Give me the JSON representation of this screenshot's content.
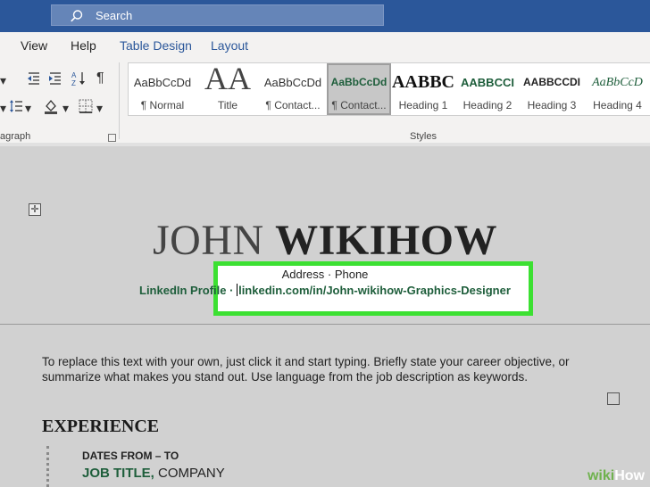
{
  "search": {
    "label": "Search"
  },
  "tabs": [
    {
      "label": "View"
    },
    {
      "label": "Help"
    },
    {
      "label": "Table Design"
    },
    {
      "label": "Layout"
    }
  ],
  "ribbon": {
    "paragraph_label": "agraph",
    "styles_label": "Styles",
    "styles": [
      {
        "sample": "AaBbCcDd",
        "name": "¶ Normal"
      },
      {
        "sample": "AA",
        "name": "Title"
      },
      {
        "sample": "AaBbCcDd",
        "name": "¶ Contact..."
      },
      {
        "sample": "AaBbCcDd",
        "name": "¶ Contact...",
        "selected": true
      },
      {
        "sample": "AABBC",
        "name": "Heading 1"
      },
      {
        "sample": "AABBCCI",
        "name": "Heading 2"
      },
      {
        "sample": "AABBCCDI",
        "name": "Heading 3"
      },
      {
        "sample": "AaBbCcD",
        "name": "Heading 4"
      }
    ]
  },
  "document": {
    "name_first": "JOHN",
    "name_last": "WIKIHOW",
    "contact_line1": "Address · Phone",
    "contact_line2_prefix": "LinkedIn Profile · ",
    "contact_url": "linkedin.com/in/John-wikihow-Graphics-Designer",
    "objective": "To replace this text with your own, just click it and start typing. Briefly state your career objective, or summarize what makes you stand out. Use language from the job description as keywords.",
    "section_heading": "EXPERIENCE",
    "dates": "DATES FROM – TO",
    "job_title": "JOB TITLE,",
    "company": " COMPANY"
  },
  "watermark": {
    "wiki": "wiki",
    "how": "How"
  },
  "colors": {
    "titlebar": "#2b579a",
    "highlight": "#3ce032",
    "link_green": "#1e5e3b"
  }
}
